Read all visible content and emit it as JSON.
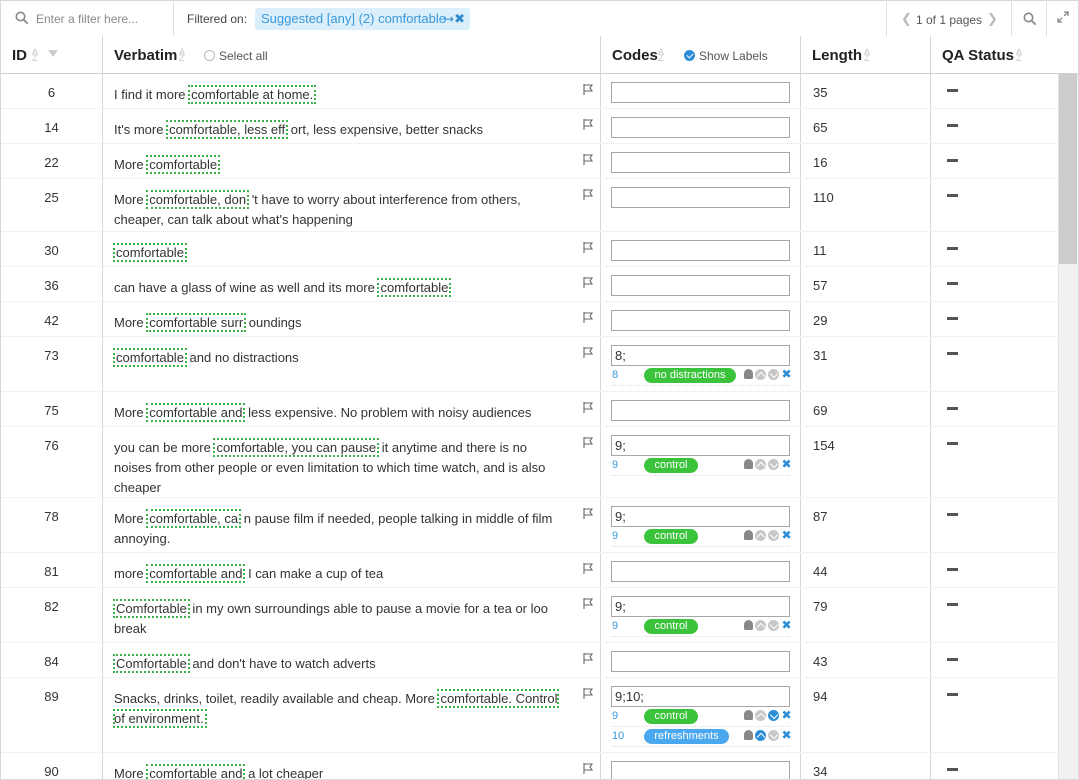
{
  "toolbar": {
    "filter_placeholder": "Enter a filter here...",
    "filtered_label": "Filtered on:",
    "filter_chip": "Suggested [any] (2) comfortable",
    "pager_text": "1 of 1 pages"
  },
  "columns": {
    "id": "ID",
    "verbatim": "Verbatim",
    "select_all": "Select all",
    "codes": "Codes",
    "show_labels": "Show Labels",
    "length": "Length",
    "qa_status": "QA Status"
  },
  "rows": [
    {
      "id": "6",
      "pre": "I find it more ",
      "hl": "comfortable at home.",
      "post": "",
      "code": "",
      "codes": [],
      "length": "35"
    },
    {
      "id": "14",
      "pre": "It's more ",
      "hl": "comfortable, less eff",
      "post": " ort, less expensive, better snacks",
      "code": "",
      "codes": [],
      "length": "65"
    },
    {
      "id": "22",
      "pre": "More ",
      "hl": "comfortable",
      "post": "",
      "code": "",
      "codes": [],
      "length": "16"
    },
    {
      "id": "25",
      "pre": "More ",
      "hl": "comfortable, don",
      "post": " 't have to worry about interference from others, cheaper, can talk about what's happening",
      "code": "",
      "codes": [],
      "length": "110"
    },
    {
      "id": "30",
      "pre": "",
      "hl": "comfortable",
      "post": "",
      "code": "",
      "codes": [],
      "length": "11"
    },
    {
      "id": "36",
      "pre": "can have a glass of wine as well and its more ",
      "hl": "comfortable",
      "post": "",
      "code": "",
      "codes": [],
      "length": "57"
    },
    {
      "id": "42",
      "pre": "More ",
      "hl": "comfortable surr",
      "post": " oundings",
      "code": "",
      "codes": [],
      "length": "29"
    },
    {
      "id": "73",
      "pre": "",
      "hl": "comfortable",
      "post": " and no distractions",
      "code": "8;",
      "codes": [
        {
          "num": "8",
          "label": "no distractions",
          "color": "green"
        }
      ],
      "length": "31"
    },
    {
      "id": "75",
      "pre": "More ",
      "hl": "comfortable and",
      "post": " less expensive. No problem with noisy audiences",
      "code": "",
      "codes": [],
      "length": "69"
    },
    {
      "id": "76",
      "pre": "you can be more ",
      "hl": "comfortable, you can pause",
      "post": " it anytime and there is no noises from other people or even limitation to which time watch, and is also cheaper",
      "code": "9;",
      "codes": [
        {
          "num": "9",
          "label": "control",
          "color": "green"
        }
      ],
      "length": "154"
    },
    {
      "id": "78",
      "pre": "More ",
      "hl": "comfortable, ca",
      "post": " n pause film if needed, people talking in middle of film annoying.",
      "code": "9;",
      "codes": [
        {
          "num": "9",
          "label": "control",
          "color": "green"
        }
      ],
      "length": "87"
    },
    {
      "id": "81",
      "pre": "more ",
      "hl": "comfortable and",
      "post": " I can make a cup of tea",
      "code": "",
      "codes": [],
      "length": "44"
    },
    {
      "id": "82",
      "pre": "",
      "hl": "Comfortable",
      "post": " in my own surroundings able to pause a movie for a tea or loo break",
      "code": "9;",
      "codes": [
        {
          "num": "9",
          "label": "control",
          "color": "green"
        }
      ],
      "length": "79"
    },
    {
      "id": "84",
      "pre": "",
      "hl": "Comfortable",
      "post": " and don't have to watch adverts",
      "code": "",
      "codes": [],
      "length": "43"
    },
    {
      "id": "89",
      "pre": "Snacks, drinks, toilet, readily available and cheap. More ",
      "hl": "comfortable. Control of environment.",
      "post": "",
      "code": "9;10;",
      "codes": [
        {
          "num": "9",
          "label": "control",
          "color": "green"
        },
        {
          "num": "10",
          "label": "refreshments",
          "color": "blue"
        }
      ],
      "length": "94"
    },
    {
      "id": "90",
      "pre": "More ",
      "hl": "comfortable and",
      "post": " a lot cheaper",
      "code": "",
      "codes": [],
      "length": "34"
    }
  ],
  "colors": {
    "accent": "#2c8fd6",
    "highlight": "#3cb34a",
    "pill_green": "#3bc43b",
    "pill_blue": "#4ca8ee"
  }
}
